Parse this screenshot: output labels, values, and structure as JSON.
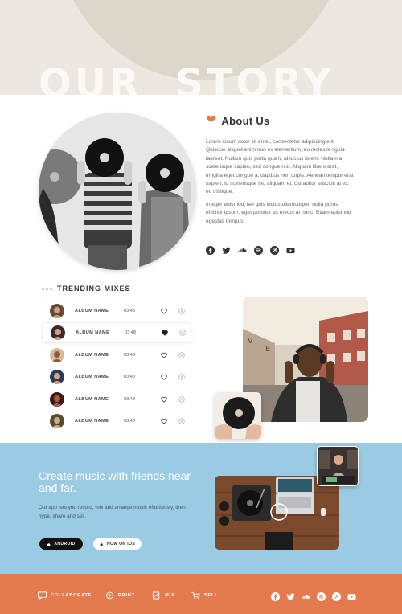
{
  "hero": {
    "title": "OUR  STORY"
  },
  "about": {
    "title": "About Us",
    "paragraph1": "Lorem ipsum dolor sit amet, consectetur adipiscing elit. Quisque aliquet enim non ex elementum, eu molestie ligula laoreet. Nullam quis porta quam, id luctus lorem. Nullam a scelerisque sapien, sed congue nisl. Aliquam libero erat, fringilla eget congue a, dapibus non turpis. Aenean tempor erat sapien, id scelerisque leo aliquam et. Curabitur suscipit at ex eu tristique.",
    "paragraph2": "Integer euismod, leo quis luctus ullamcorper, nulla purus efficitur ipsum, eget porttitor ex metus at nunc. Etiam euismod egestas tempus.",
    "social": [
      "facebook-icon",
      "twitter-icon",
      "soundcloud-icon",
      "spotify-icon",
      "deezer-icon",
      "youtube-icon"
    ]
  },
  "trending": {
    "title": "TRENDING MIXES",
    "tracks": [
      {
        "name": "ALBUM NAME",
        "time": "03:48",
        "liked": false
      },
      {
        "name": "ALBUM NAME",
        "time": "03:48",
        "liked": true
      },
      {
        "name": "ALBUM NAME",
        "time": "03:48",
        "liked": false
      },
      {
        "name": "ALBUM NAME",
        "time": "03:48",
        "liked": false
      },
      {
        "name": "ALBUM NAME",
        "time": "03:48",
        "liked": false
      },
      {
        "name": "ALBUM NAME",
        "time": "03:48",
        "liked": false
      }
    ]
  },
  "promo": {
    "title": "Create music with friends near and far.",
    "description": "Our app lets you record, mix and arrange music effortlessly, then hype, share and sell.",
    "android_label": "ANDROID",
    "ios_label": "NOW ON IOS"
  },
  "footer": {
    "nav": [
      "COLLABORATE",
      "PRINT",
      "MIX",
      "SELL"
    ],
    "social": [
      "facebook-icon",
      "twitter-icon",
      "soundcloud-icon",
      "spotify-icon",
      "deezer-icon",
      "youtube-icon"
    ]
  },
  "colors": {
    "accent": "#e47a4d",
    "blue": "#9bcbe2",
    "hero_bg": "#ece8e1",
    "dots": "#7cc1df"
  }
}
